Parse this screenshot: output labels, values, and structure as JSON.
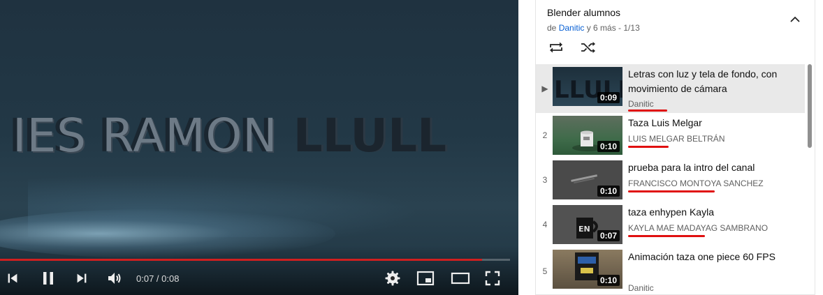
{
  "player": {
    "video_text_part1": "IES RAMON ",
    "video_text_part2": "LLULL",
    "time": "0:07 / 0:08",
    "progress": 0.945
  },
  "playlist": {
    "title": "Blender alumnos",
    "subtitle_prefix": "de ",
    "owner": "Danitic",
    "subtitle_suffix": " y 6 más - 1/13",
    "items": [
      {
        "index": "▶",
        "title": "Letras con luz y tela de fondo, con movimiento de cámara",
        "channel": "Danitic",
        "duration": "0:09"
      },
      {
        "index": "2",
        "title": "Taza Luis Melgar",
        "channel": "LUIS MELGAR BELTRÁN",
        "duration": "0:10"
      },
      {
        "index": "3",
        "title": "prueba para la intro del canal",
        "channel": "FRANCISCO MONTOYA SANCHEZ",
        "duration": "0:10"
      },
      {
        "index": "4",
        "title": "taza enhypen Kayla",
        "channel": "KAYLA MAE MADAYAG SAMBRANO",
        "duration": "0:07"
      },
      {
        "index": "5",
        "title": "Animación taza one piece 60 FPS",
        "channel": "Danitic",
        "duration": "0:10"
      }
    ]
  },
  "colors": {
    "accent": "#d11f1f",
    "link": "#065fd4",
    "annotation": "#e01010"
  }
}
